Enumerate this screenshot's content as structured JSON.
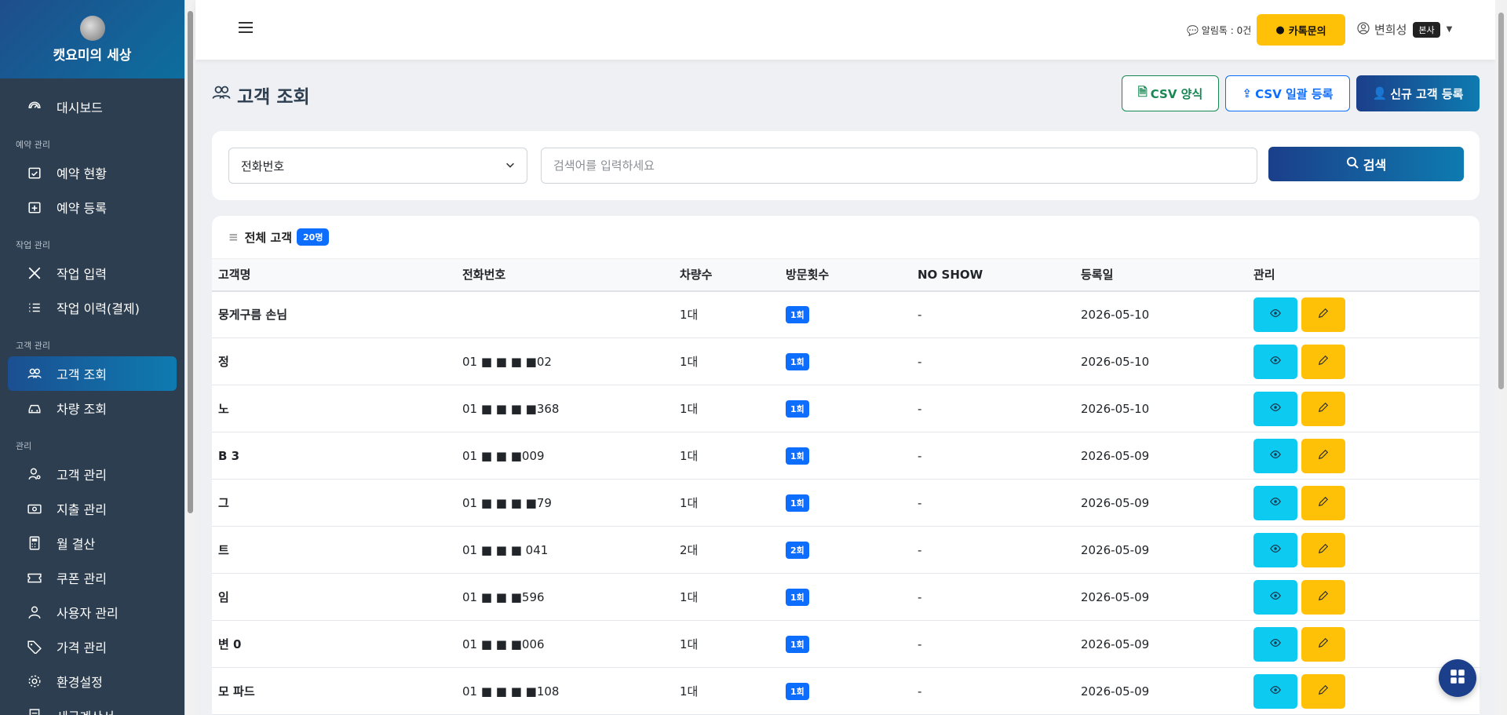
{
  "brand": {
    "name": "캣요미의 세상"
  },
  "sidebar": {
    "top_item": {
      "label": "대시보드",
      "icon": "gauge-icon"
    },
    "sections": [
      {
        "title": "예약 관리",
        "items": [
          {
            "label": "예약 현황",
            "icon": "calendar-check-icon"
          },
          {
            "label": "예약 등록",
            "icon": "calendar-plus-icon"
          }
        ]
      },
      {
        "title": "작업 관리",
        "items": [
          {
            "label": "작업 입력",
            "icon": "tools-icon"
          },
          {
            "label": "작업 이력(결제)",
            "icon": "list-check-icon"
          }
        ]
      },
      {
        "title": "고객 관리",
        "items": [
          {
            "label": "고객 조회",
            "icon": "people-icon",
            "active": true
          },
          {
            "label": "차량 조회",
            "icon": "car-icon"
          }
        ]
      },
      {
        "title": "관리",
        "items": [
          {
            "label": "고객 관리",
            "icon": "person-gear-icon"
          },
          {
            "label": "지출 관리",
            "icon": "cash-icon"
          },
          {
            "label": "월 결산",
            "icon": "calculator-icon"
          },
          {
            "label": "쿠폰 관리",
            "icon": "ticket-icon"
          },
          {
            "label": "사용자 관리",
            "icon": "person-icon"
          },
          {
            "label": "가격 관리",
            "icon": "tag-icon"
          },
          {
            "label": "환경설정",
            "icon": "gear-icon"
          },
          {
            "label": "세금계산서",
            "icon": "receipt-icon"
          }
        ]
      }
    ]
  },
  "topbar": {
    "alert_text": "알림톡 : 0건",
    "kakao_label": "카톡문의",
    "user_name": "변희성",
    "user_badge": "본사"
  },
  "page": {
    "title": "고객 조회",
    "csv_form_label": "CSV 양식",
    "csv_bulk_label": "CSV 일괄 등록",
    "new_customer_label": "신규 고객 등록"
  },
  "search": {
    "field_selected": "전화번호",
    "placeholder": "검색어를 입력하세요",
    "button_label": "검색"
  },
  "table": {
    "heading": "전체 고객",
    "count_badge": "20명",
    "columns": [
      "고객명",
      "전화번호",
      "차량수",
      "방문횟수",
      "NO SHOW",
      "등록일",
      "관리"
    ],
    "rows": [
      {
        "name": "뭉게구름 손님",
        "phone": "",
        "cars": "1대",
        "visits": "1회",
        "noshow": "-",
        "date": "2026-05-10"
      },
      {
        "name": "정",
        "phone": "01 ■ ■ ■ ■02",
        "cars": "1대",
        "visits": "1회",
        "noshow": "-",
        "date": "2026-05-10"
      },
      {
        "name": "노",
        "phone": "01 ■ ■ ■ ■368",
        "cars": "1대",
        "visits": "1회",
        "noshow": "-",
        "date": "2026-05-10"
      },
      {
        "name": "B 3",
        "phone": "01 ■ ■ ■009",
        "cars": "1대",
        "visits": "1회",
        "noshow": "-",
        "date": "2026-05-09"
      },
      {
        "name": "그",
        "phone": "01 ■ ■ ■ ■79",
        "cars": "1대",
        "visits": "1회",
        "noshow": "-",
        "date": "2026-05-09"
      },
      {
        "name": "트",
        "phone": "01 ■ ■ ■ 041",
        "cars": "2대",
        "visits": "2회",
        "noshow": "-",
        "date": "2026-05-09"
      },
      {
        "name": "임",
        "phone": "01 ■ ■ ■596",
        "cars": "1대",
        "visits": "1회",
        "noshow": "-",
        "date": "2026-05-09"
      },
      {
        "name": "변 0",
        "phone": "01 ■ ■ ■006",
        "cars": "1대",
        "visits": "1회",
        "noshow": "-",
        "date": "2026-05-09"
      },
      {
        "name": "모 파드",
        "phone": "01 ■ ■ ■ ■108",
        "cars": "1대",
        "visits": "1회",
        "noshow": "-",
        "date": "2026-05-09"
      }
    ]
  }
}
